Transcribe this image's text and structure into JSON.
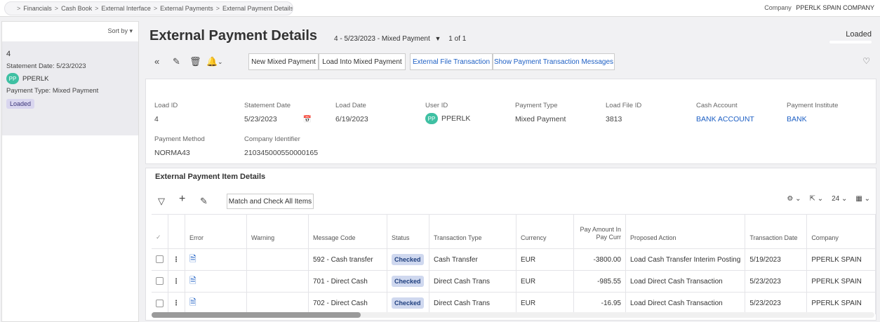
{
  "breadcrumb": [
    "Financials",
    "Cash Book",
    "External Interface",
    "External Payments",
    "External Payment Details"
  ],
  "company": {
    "label": "Company",
    "value": "PPERLK SPAIN COMPANY"
  },
  "left": {
    "sort_label": "Sort by",
    "item": {
      "id": "4",
      "statement_date": "Statement Date:  5/23/2023",
      "avatar_initials": "PP",
      "user": "PPERLK",
      "payment_type": "Payment Type:  Mixed Payment",
      "status": "Loaded"
    }
  },
  "header": {
    "title": "External Payment Details",
    "record": "4 - 5/23/2023 - Mixed Payment",
    "pager": "1 of 1",
    "status": "Loaded"
  },
  "toolbar": {
    "buttons": [
      "New Mixed Payment",
      "Load Into Mixed Payment",
      "External File Transaction",
      "Show Payment Transaction Messages"
    ]
  },
  "details": {
    "load_id": {
      "label": "Load ID",
      "value": "4"
    },
    "statement_date": {
      "label": "Statement Date",
      "value": "5/23/2023"
    },
    "load_date": {
      "label": "Load Date",
      "value": "6/19/2023"
    },
    "user_id": {
      "label": "User ID",
      "initials": "PP",
      "value": "PPERLK"
    },
    "payment_type": {
      "label": "Payment Type",
      "value": "Mixed Payment"
    },
    "load_file_id": {
      "label": "Load File ID",
      "value": "3813"
    },
    "cash_account": {
      "label": "Cash Account",
      "value": "BANK ACCOUNT"
    },
    "payment_institute": {
      "label": "Payment Institute",
      "value": "BANK"
    },
    "payment_method": {
      "label": "Payment Method",
      "value": "NORMA43"
    },
    "company_identifier": {
      "label": "Company Identifier",
      "value": "210345000550000165"
    }
  },
  "items": {
    "title": "External Payment Item Details",
    "match_button": "Match and Check All Items",
    "page_size": "24",
    "columns": [
      "Error",
      "Warning",
      "Message Code",
      "Status",
      "Transaction Type",
      "Currency",
      "Pay Amount In Pay Curr",
      "Proposed Action",
      "Transaction Date",
      "Company"
    ],
    "rows": [
      {
        "message_code": "592 - Cash transfer",
        "status": "Checked",
        "transaction_type": "Cash Transfer",
        "currency": "EUR",
        "amount": "-3800.00",
        "action": "Load Cash Transfer Interim Posting",
        "date": "5/19/2023",
        "company": "PPERLK SPAIN"
      },
      {
        "message_code": "701 - Direct Cash",
        "status": "Checked",
        "transaction_type": "Direct Cash Trans",
        "currency": "EUR",
        "amount": "-985.55",
        "action": "Load Direct Cash Transaction",
        "date": "5/23/2023",
        "company": "PPERLK SPAIN"
      },
      {
        "message_code": "702 - Direct Cash",
        "status": "Checked",
        "transaction_type": "Direct Cash Trans",
        "currency": "EUR",
        "amount": "-16.95",
        "action": "Load Direct Cash Transaction",
        "date": "5/23/2023",
        "company": "PPERLK SPAIN"
      }
    ]
  }
}
